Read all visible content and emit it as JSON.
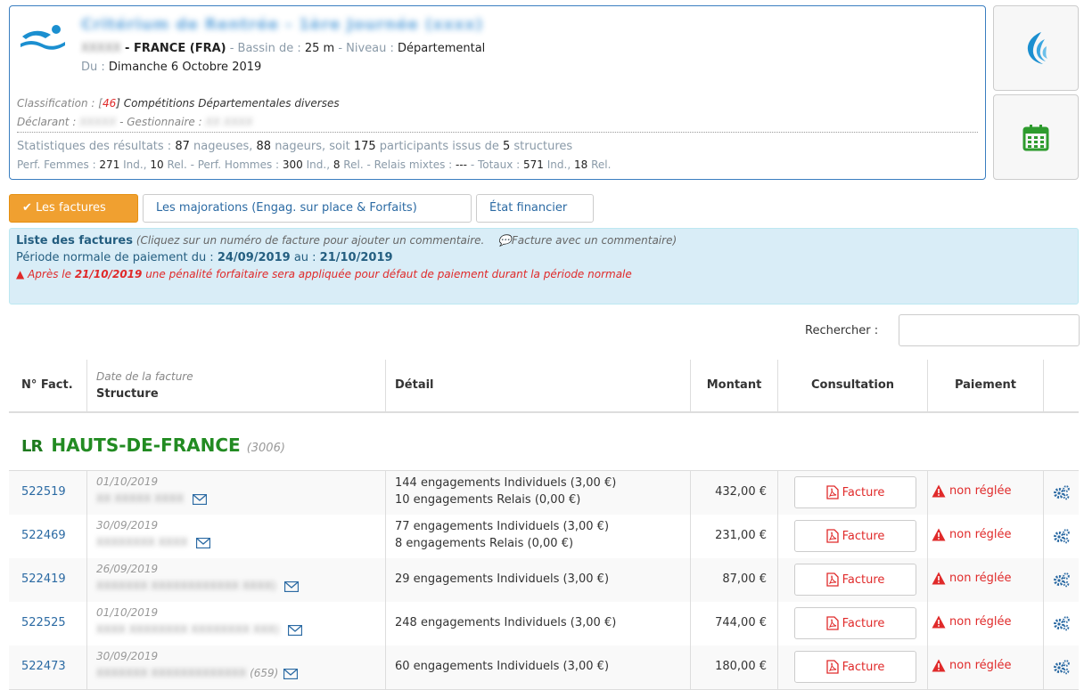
{
  "meet": {
    "title": "Critérium de Rentrée - 1ère Journée (xxxx)",
    "location_blurred": "XXXXX",
    "country": " - FRANCE (FRA)",
    "pool_label": " - Bassin de : ",
    "pool_value": "25 m",
    "level_label": " - Niveau : ",
    "level_value": "Départemental",
    "date_label": "Du : ",
    "date_value": "Dimanche 6 Octobre 2019",
    "classification_label": "Classification : [",
    "classification_num": "46",
    "classification_value": "] Compétitions Départementales diverses",
    "declarant_label": "Déclarant : ",
    "declarant_value": "XXXXX",
    "manager_label": " - Gestionnaire : ",
    "manager_value": "XX XXXX"
  },
  "stats": {
    "line1_prefix": "Statistiques des résultats : ",
    "swimmers_f": "87",
    "swimmers_f_label": " nageuses, ",
    "swimmers_m": "88",
    "swimmers_m_label": " nageurs, soit ",
    "participants": "175",
    "participants_label": " participants issus de ",
    "structures": "5",
    "structures_label": " structures",
    "line2_prefix": "Perf. Femmes : ",
    "f_ind": "271",
    "ind_label": " Ind., ",
    "f_rel": "10",
    "rel_label1": " Rel. - Perf. Hommes : ",
    "m_ind": "300",
    "ind_label2": " Ind., ",
    "m_rel": "8",
    "rel_label2": " Rel. - Relais mixtes : ",
    "mixed": "---",
    "totals_label": " - Totaux : ",
    "t_ind": "571",
    "ind_label3": " Ind., ",
    "t_rel": "18",
    "rel_label3": " Rel."
  },
  "tabs": [
    {
      "label": "Les factures"
    },
    {
      "label": "Les majorations (Engag. sur place & Forfaits)"
    },
    {
      "label": "État financier"
    }
  ],
  "info": {
    "title": "Liste des factures",
    "hint": " (Cliquez sur un numéro de facture pour ajouter un commentaire.",
    "hint2": "Facture avec un commentaire)",
    "period_label": "Période normale de paiement du : ",
    "period_from": "24/09/2019",
    "period_mid": " au : ",
    "period_to": "21/10/2019",
    "warning_pre": "Après le ",
    "warning_date": "21/10/2019",
    "warning_post": " une pénalité forfaitaire sera appliquée pour défaut de paiement durant la période normale"
  },
  "search": {
    "label": "Rechercher :",
    "placeholder": ""
  },
  "table": {
    "headers": {
      "num": "N° Fact.",
      "date": "Date de la facture",
      "structure": "Structure",
      "detail": "Détail",
      "amount": "Montant",
      "consult": "Consultation",
      "payment": "Paiement"
    },
    "group": {
      "prefix": "LR",
      "name": "HAUTS-DE-FRANCE",
      "code": "(3006)"
    },
    "facture_label": "Facture",
    "status_label": "non réglée",
    "rows": [
      {
        "num": "522519",
        "date": "01/10/2019",
        "structure": "XX XXXXX XXXX",
        "structure_code": "",
        "detail1": "144 engagements Individuels (3,00 €)",
        "detail2": "10 engagements Relais (0,00 €)",
        "amount": "432,00 €"
      },
      {
        "num": "522469",
        "date": "30/09/2019",
        "structure": "XXXXXXXX XXXX",
        "structure_code": "",
        "detail1": "77 engagements Individuels (3,00 €)",
        "detail2": "8 engagements Relais (0,00 €)",
        "amount": "231,00 €"
      },
      {
        "num": "522419",
        "date": "26/09/2019",
        "structure": "XXXXXXX XXXXXXXXXXXX XXXX)",
        "structure_code": "",
        "detail1": "29 engagements Individuels (3,00 €)",
        "detail2": "",
        "amount": "87,00 €"
      },
      {
        "num": "522525",
        "date": "01/10/2019",
        "structure": "XXXX XXXXXXXX XXXXXXXX XXX)",
        "structure_code": "",
        "detail1": "248 engagements Individuels (3,00 €)",
        "detail2": "",
        "amount": "744,00 €"
      },
      {
        "num": "522473",
        "date": "30/09/2019",
        "structure": "XXXXXXX XXXXXXXXXXXXX",
        "structure_code": "(659)",
        "detail1": "60 engagements Individuels (3,00 €)",
        "detail2": "",
        "amount": "180,00 €"
      }
    ]
  },
  "colors": {
    "accent": "#f0a030",
    "link": "#2b6aa3",
    "danger": "#e02a2a",
    "group": "#228b22",
    "info_bg": "#d9edf7"
  }
}
